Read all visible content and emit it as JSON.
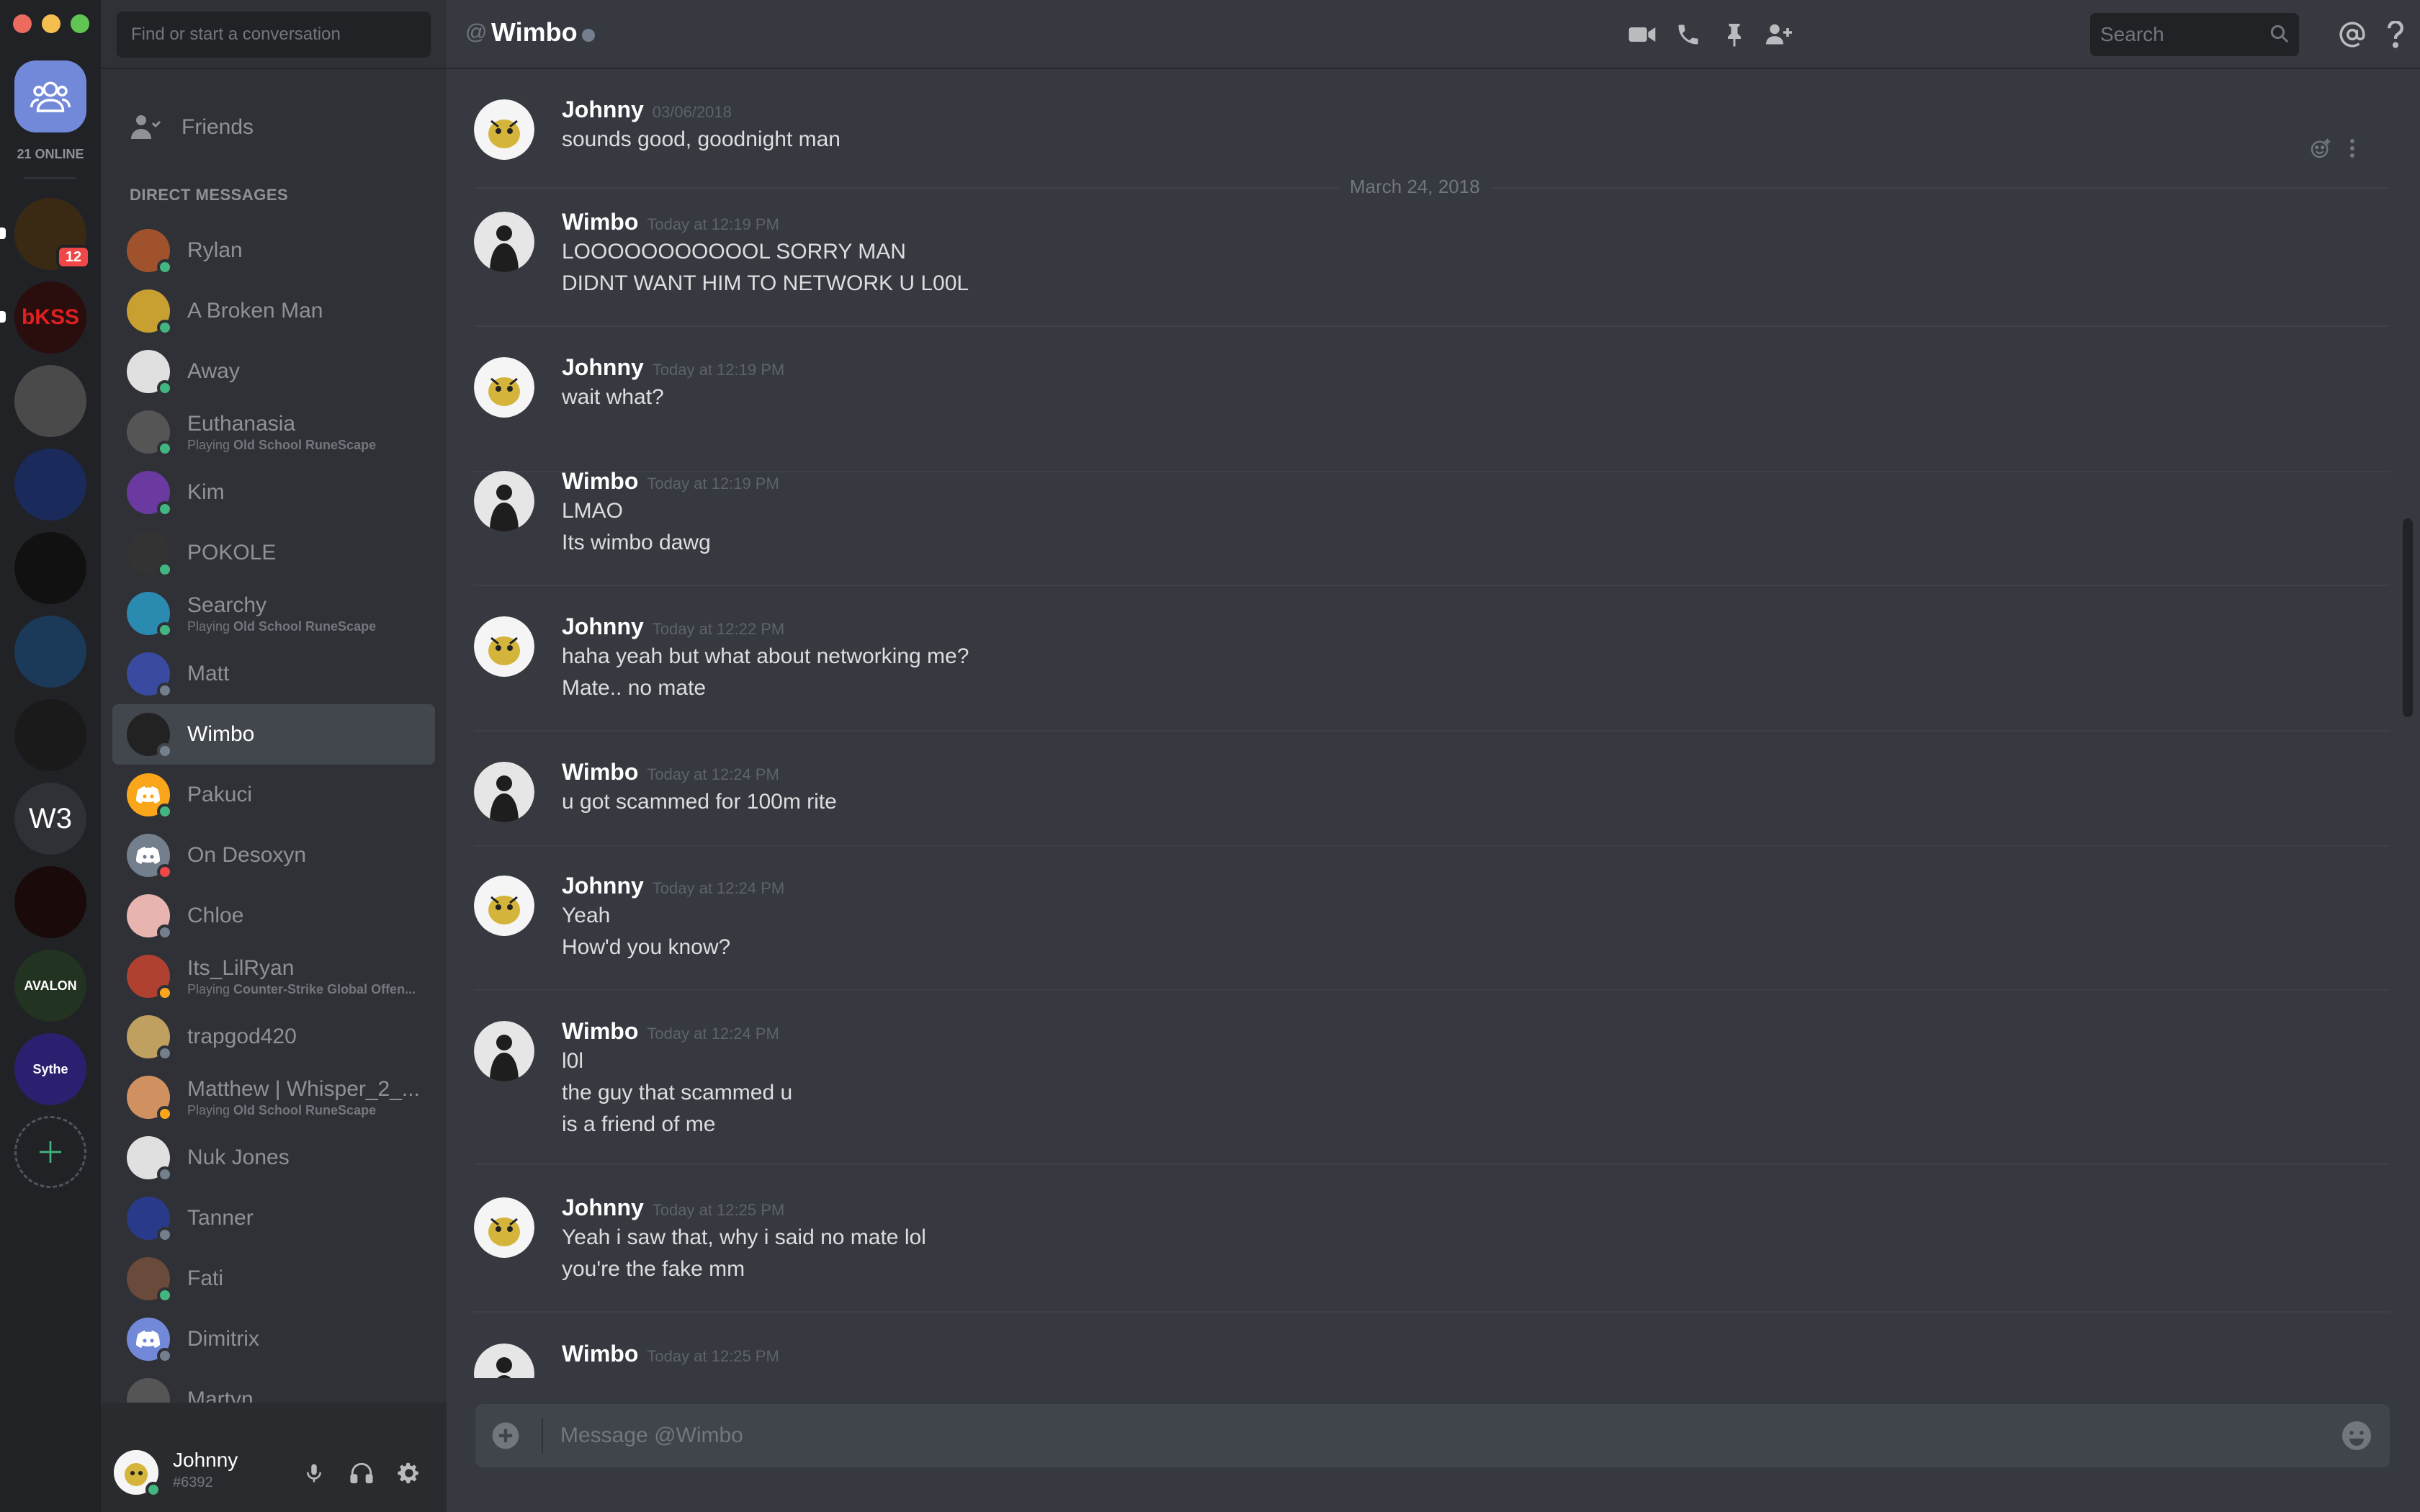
{
  "colors": {
    "blurple": "#7289da",
    "online": "#43b581",
    "idle": "#faa61a",
    "dnd": "#f04747",
    "offline": "#747f8d"
  },
  "window": {
    "buttons": [
      "close",
      "minimize",
      "zoom"
    ]
  },
  "servers": {
    "online_label": "21 ONLINE",
    "unread_badge": "12",
    "items": [
      {
        "name": "server-viking",
        "color": "#3a2a14"
      },
      {
        "name": "server-bkss",
        "text": "bKSS",
        "color": "#2a0d0d"
      },
      {
        "name": "server-bearded-man",
        "color": "#4a4a4a"
      },
      {
        "name": "server-un-globe",
        "color": "#1a2a5a"
      },
      {
        "name": "server-ghost",
        "color": "#111111"
      },
      {
        "name": "server-blue-globe",
        "color": "#1b3a5a"
      },
      {
        "name": "server-runescape-char",
        "color": "#1a1a1a"
      },
      {
        "name": "server-w3",
        "text": "W3",
        "color": "#2f3136"
      },
      {
        "name": "server-red-beast",
        "color": "#1a0a0a"
      },
      {
        "name": "server-avalon",
        "text": "AVALON",
        "color": "#223322"
      },
      {
        "name": "server-sythe",
        "text": "Sythe",
        "color": "#2a2070"
      }
    ]
  },
  "sidebar": {
    "search_placeholder": "Find or start a conversation",
    "friends_label": "Friends",
    "dm_header": "DIRECT MESSAGES",
    "dms": [
      {
        "name": "Rylan",
        "status": "online",
        "avatar": "#a0522d"
      },
      {
        "name": "A Broken Man",
        "status": "online",
        "avatar": "#c8a032"
      },
      {
        "name": "Away",
        "status": "online",
        "avatar": "#e0e0e0"
      },
      {
        "name": "Euthanasia",
        "status": "online",
        "avatar": "#555555",
        "activity_prefix": "Playing ",
        "activity_game": "Old School RuneScape"
      },
      {
        "name": "Kim",
        "status": "online",
        "avatar": "#6a3aa0"
      },
      {
        "name": "POKOLE",
        "status": "online",
        "avatar": "#333333"
      },
      {
        "name": "Searchy",
        "status": "online",
        "avatar": "#2a8ab0",
        "activity_prefix": "Playing ",
        "activity_game": "Old School RuneScape"
      },
      {
        "name": "Matt",
        "status": "offline",
        "avatar": "#3a4aa0"
      },
      {
        "name": "Wimbo",
        "status": "offline",
        "avatar": "#222222",
        "active": true
      },
      {
        "name": "Pakuci",
        "status": "online",
        "avatar": "#faa61a",
        "discord": true
      },
      {
        "name": "On Desoxyn",
        "status": "dnd",
        "avatar": "#747f8d",
        "discord": true
      },
      {
        "name": "Chloe",
        "status": "offline",
        "avatar": "#e8b4b0"
      },
      {
        "name": "Its_LilRyan",
        "status": "idle",
        "avatar": "#b04030",
        "activity_prefix": "Playing ",
        "activity_game": "Counter-Strike Global Offen..."
      },
      {
        "name": "trapgod420",
        "status": "offline",
        "avatar": "#c0a060"
      },
      {
        "name": "Matthew | Whisper_2_...",
        "status": "idle",
        "avatar": "#d09060",
        "activity_prefix": "Playing ",
        "activity_game": "Old School RuneScape"
      },
      {
        "name": "Nuk Jones",
        "status": "offline",
        "avatar": "#e0e0e0"
      },
      {
        "name": "Tanner",
        "status": "offline",
        "avatar": "#2a3a8a"
      },
      {
        "name": "Fati",
        "status": "online",
        "avatar": "#6a4a3a"
      },
      {
        "name": "Dimitrix",
        "status": "offline",
        "avatar": "#7289da",
        "discord": true
      },
      {
        "name": "Martyn",
        "status": "offline",
        "avatar": "#555555"
      }
    ]
  },
  "user_panel": {
    "name": "Johnny",
    "tag": "#6392"
  },
  "header": {
    "at": "@",
    "title": "Wimbo",
    "search_placeholder": "Search"
  },
  "messages": {
    "date_divider": "March 24, 2018",
    "groups": [
      {
        "author": "Johnny",
        "time": "03/06/2018",
        "lines": [
          "sounds good, goodnight man"
        ],
        "avatar": "johnny"
      },
      {
        "author": "Wimbo",
        "time": "Today at 12:19 PM",
        "lines": [
          "LOOOOOOOOOOOL SORRY MAN",
          "DIDNT WANT HIM TO NETWORK U L00L"
        ],
        "avatar": "wimbo"
      },
      {
        "author": "Johnny",
        "time": "Today at 12:19 PM",
        "lines": [
          "wait what?"
        ],
        "avatar": "johnny"
      },
      {
        "author": "Wimbo",
        "time": "Today at 12:19 PM",
        "lines": [
          "LMAO",
          "Its wimbo dawg"
        ],
        "avatar": "wimbo"
      },
      {
        "author": "Johnny",
        "time": "Today at 12:22 PM",
        "lines": [
          "haha yeah but what about networking me?",
          "Mate.. no mate"
        ],
        "avatar": "johnny"
      },
      {
        "author": "Wimbo",
        "time": "Today at 12:24 PM",
        "lines": [
          "u got scammed for 100m rite"
        ],
        "avatar": "wimbo"
      },
      {
        "author": "Johnny",
        "time": "Today at 12:24 PM",
        "lines": [
          "Yeah",
          "How'd you know?"
        ],
        "avatar": "johnny"
      },
      {
        "author": "Wimbo",
        "time": "Today at 12:24 PM",
        "lines": [
          "l0l",
          "the guy that scammed u",
          "is a friend of me"
        ],
        "avatar": "wimbo"
      },
      {
        "author": "Johnny",
        "time": "Today at 12:25 PM",
        "lines": [
          "Yeah i saw that, why i said no mate lol",
          "you're the fake mm"
        ],
        "avatar": "johnny"
      },
      {
        "author": "Wimbo",
        "time": "Today at 12:25 PM",
        "lines": [],
        "avatar": "wimbo"
      }
    ]
  },
  "composer": {
    "placeholder": "Message @Wimbo"
  }
}
